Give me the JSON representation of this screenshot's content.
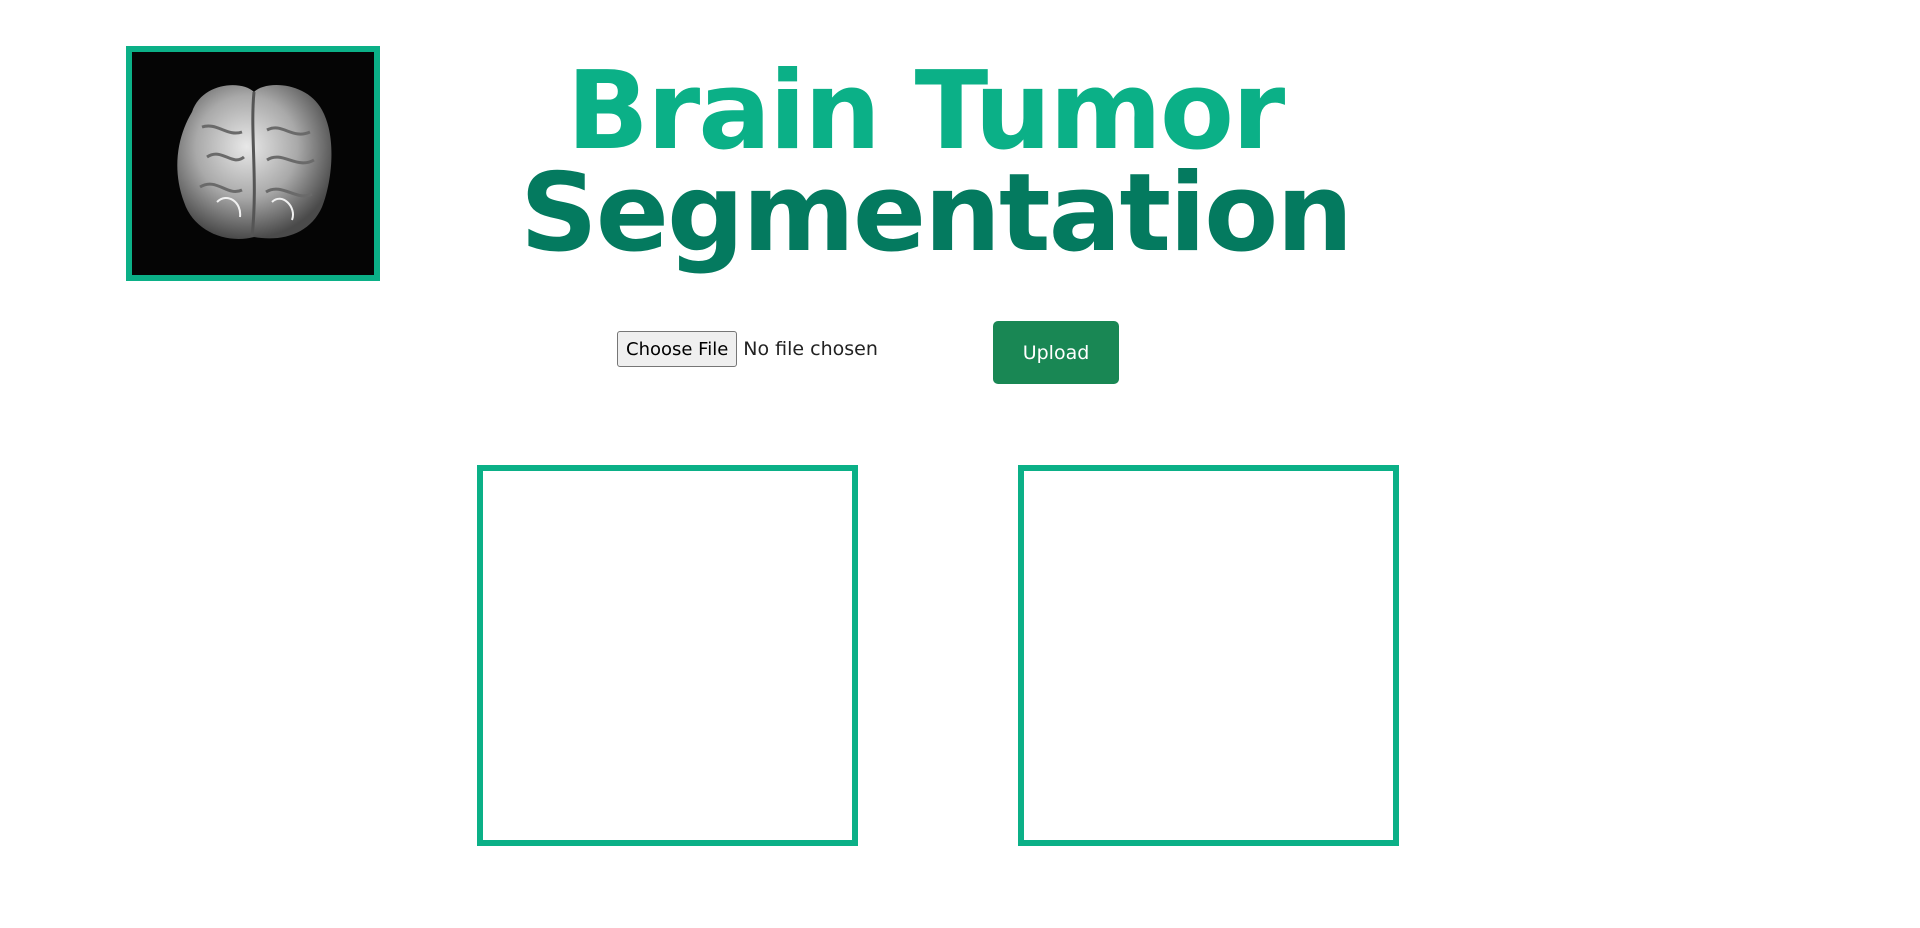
{
  "header": {
    "title_line1": "Brain Tumor",
    "title_line2": "Segmentation",
    "logo_icon": "brain-icon"
  },
  "upload_form": {
    "choose_file_label": "Choose File",
    "file_status": "No file chosen",
    "upload_label": "Upload"
  },
  "colors": {
    "accent": "#0bb087",
    "accent_dark": "#047a5f",
    "button_green": "#198754"
  }
}
